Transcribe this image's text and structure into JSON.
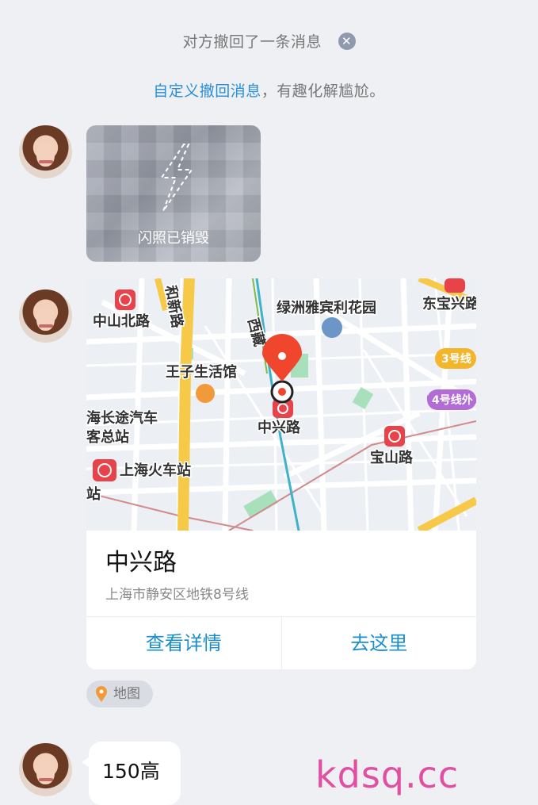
{
  "system": {
    "recall_text": "对方撤回了一条消息",
    "custom_recall_link": "自定义撤回消息",
    "custom_recall_rest": "，有趣化解尴尬。"
  },
  "flash_photo": {
    "label": "闪照已销毁"
  },
  "location_card": {
    "map_labels": {
      "zhongshan_north": "中山北路",
      "hexin_road": "和新路",
      "xizang_road": "西藏",
      "lvzhou": "绿洲雅宾利花园",
      "dongbao": "东宝兴路",
      "line3": "3号线",
      "line4": "4号线外",
      "wangzi": "王子生活馆",
      "zhongxing_station": "中兴路",
      "bus_station_1": "海长途汽车",
      "bus_station_2": "客总站",
      "railway_station": "上海火车站",
      "baoshan": "宝山路",
      "zhan": "站"
    },
    "name": "中兴路",
    "address": "上海市静安区地铁8号线",
    "action_details": "查看详情",
    "action_go": "去这里"
  },
  "source_tag": {
    "label": "地图"
  },
  "last_message": {
    "text": "150高"
  },
  "watermark": "kdsq.cc",
  "colors": {
    "link": "#2a8fd6",
    "action": "#1a8ec9",
    "pin_red": "#f0462e",
    "metro_red": "#e8424a",
    "watermark": "#e14fa0"
  }
}
